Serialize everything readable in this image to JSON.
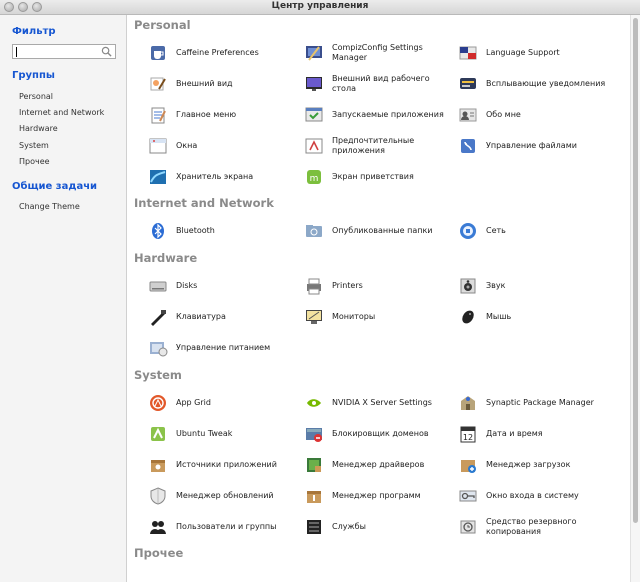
{
  "window": {
    "title": "Центр управления"
  },
  "sidebar": {
    "filter_title": "Фильтр",
    "search_value": "",
    "groups_title": "Группы",
    "groups": [
      "Personal",
      "Internet and Network",
      "Hardware",
      "System",
      "Прочее"
    ],
    "tasks_title": "Общие задачи",
    "tasks": [
      "Change Theme"
    ]
  },
  "sections": [
    {
      "title": "Personal",
      "items": [
        {
          "label": "Caffeine Preferences",
          "icon": "coffee-cup-icon"
        },
        {
          "label": "CompizConfig Settings Manager",
          "icon": "compiz-icon"
        },
        {
          "label": "Language Support",
          "icon": "language-icon"
        },
        {
          "label": "Внешний вид",
          "icon": "appearance-brush-icon"
        },
        {
          "label": "Внешний вид рабочего стола",
          "icon": "desktop-wallpaper-icon"
        },
        {
          "label": "Всплывающие уведомления",
          "icon": "notification-icon"
        },
        {
          "label": "Главное меню",
          "icon": "main-menu-icon"
        },
        {
          "label": "Запускаемые приложения",
          "icon": "startup-apps-icon"
        },
        {
          "label": "Обо мне",
          "icon": "about-me-icon"
        },
        {
          "label": "Окна",
          "icon": "windows-icon"
        },
        {
          "label": "Предпочтительные приложения",
          "icon": "preferred-apps-icon"
        },
        {
          "label": "Управление файлами",
          "icon": "file-manager-icon"
        },
        {
          "label": "Хранитель экрана",
          "icon": "screensaver-icon"
        },
        {
          "label": "Экран приветствия",
          "icon": "welcome-screen-icon"
        }
      ]
    },
    {
      "title": "Internet and Network",
      "items": [
        {
          "label": "Bluetooth",
          "icon": "bluetooth-icon"
        },
        {
          "label": "Опубликованные папки",
          "icon": "shared-folders-icon"
        },
        {
          "label": "Сеть",
          "icon": "network-icon"
        }
      ]
    },
    {
      "title": "Hardware",
      "items": [
        {
          "label": "Disks",
          "icon": "disks-icon"
        },
        {
          "label": "Printers",
          "icon": "printer-icon"
        },
        {
          "label": "Звук",
          "icon": "sound-icon"
        },
        {
          "label": "Клавиатура",
          "icon": "keyboard-icon"
        },
        {
          "label": "Мониторы",
          "icon": "monitor-icon"
        },
        {
          "label": "Мышь",
          "icon": "mouse-icon"
        },
        {
          "label": "Управление питанием",
          "icon": "power-icon"
        }
      ]
    },
    {
      "title": "System",
      "items": [
        {
          "label": "App Grid",
          "icon": "app-grid-icon"
        },
        {
          "label": "NVIDIA X Server Settings",
          "icon": "nvidia-icon"
        },
        {
          "label": "Synaptic Package Manager",
          "icon": "synaptic-icon"
        },
        {
          "label": "Ubuntu Tweak",
          "icon": "ubuntu-tweak-icon"
        },
        {
          "label": "Блокировщик доменов",
          "icon": "domain-blocker-icon"
        },
        {
          "label": "Дата и время",
          "icon": "calendar-icon"
        },
        {
          "label": "Источники приложений",
          "icon": "software-sources-icon"
        },
        {
          "label": "Менеджер драйверов",
          "icon": "driver-manager-icon"
        },
        {
          "label": "Менеджер загрузок",
          "icon": "boot-manager-icon"
        },
        {
          "label": "Менеджер обновлений",
          "icon": "update-shield-icon"
        },
        {
          "label": "Менеджер программ",
          "icon": "software-manager-icon"
        },
        {
          "label": "Окно входа в систему",
          "icon": "login-window-icon"
        },
        {
          "label": "Пользователи и группы",
          "icon": "users-icon"
        },
        {
          "label": "Службы",
          "icon": "services-icon"
        },
        {
          "label": "Средство резервного копирования",
          "icon": "backup-icon"
        }
      ]
    },
    {
      "title": "Прочее",
      "items": []
    }
  ]
}
